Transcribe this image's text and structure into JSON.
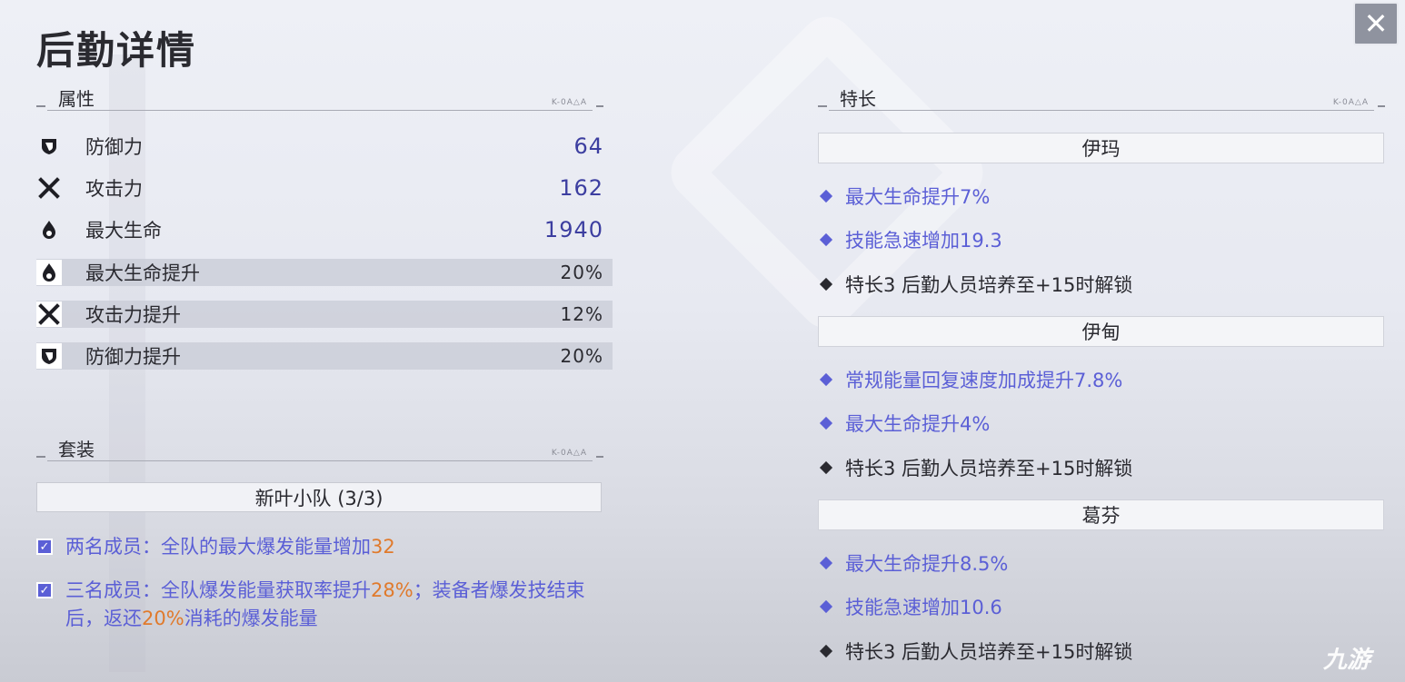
{
  "title": "后勤详情",
  "close_icon": "close-icon",
  "attributes": {
    "header": "属性",
    "header_code": "K-0A△A",
    "rows": [
      {
        "icon": "shield-icon",
        "label": "防御力",
        "value": "64"
      },
      {
        "icon": "crossed-swords-icon",
        "label": "攻击力",
        "value": "162"
      },
      {
        "icon": "droplet-icon",
        "label": "最大生命",
        "value": "1940"
      },
      {
        "icon": "droplet-icon",
        "label": "最大生命提升",
        "value": "20%"
      },
      {
        "icon": "crossed-swords-icon",
        "label": "攻击力提升",
        "value": "12%"
      },
      {
        "icon": "shield-icon",
        "label": "防御力提升",
        "value": "20%"
      }
    ]
  },
  "set": {
    "header": "套装",
    "header_code": "K-0A△A",
    "name": "新叶小队 (3/3)",
    "effects": [
      {
        "prefix": "两名成员：全队的最大爆发能量增加",
        "hl1": "32",
        "mid": "",
        "hl2": "",
        "suffix": ""
      },
      {
        "prefix": "三名成员：全队爆发能量获取率提升",
        "hl1": "28%",
        "mid": "；装备者爆发技结束后，返还",
        "hl2": "20%",
        "suffix": "消耗的爆发能量"
      }
    ]
  },
  "traits": {
    "header": "特长",
    "header_code": "K-0A△A",
    "characters": [
      {
        "name": "伊玛",
        "items": [
          {
            "text": "最大生命提升7%",
            "active": true
          },
          {
            "text": "技能急速增加19.3",
            "active": true
          },
          {
            "text": "特长3  后勤人员培养至+15时解锁",
            "active": false
          }
        ]
      },
      {
        "name": "伊甸",
        "items": [
          {
            "text": "常规能量回复速度加成提升7.8%",
            "active": true
          },
          {
            "text": "最大生命提升4%",
            "active": true
          },
          {
            "text": "特长3  后勤人员培养至+15时解锁",
            "active": false
          }
        ]
      },
      {
        "name": "葛芬",
        "items": [
          {
            "text": "最大生命提升8.5%",
            "active": true
          },
          {
            "text": "技能急速增加10.6",
            "active": true
          },
          {
            "text": "特长3  后勤人员培养至+15时解锁",
            "active": false
          }
        ]
      }
    ]
  },
  "watermark": "九游",
  "colors": {
    "accent": "#5b5fd6",
    "highlight": "#e07a2c",
    "value": "#3c3ea0"
  }
}
